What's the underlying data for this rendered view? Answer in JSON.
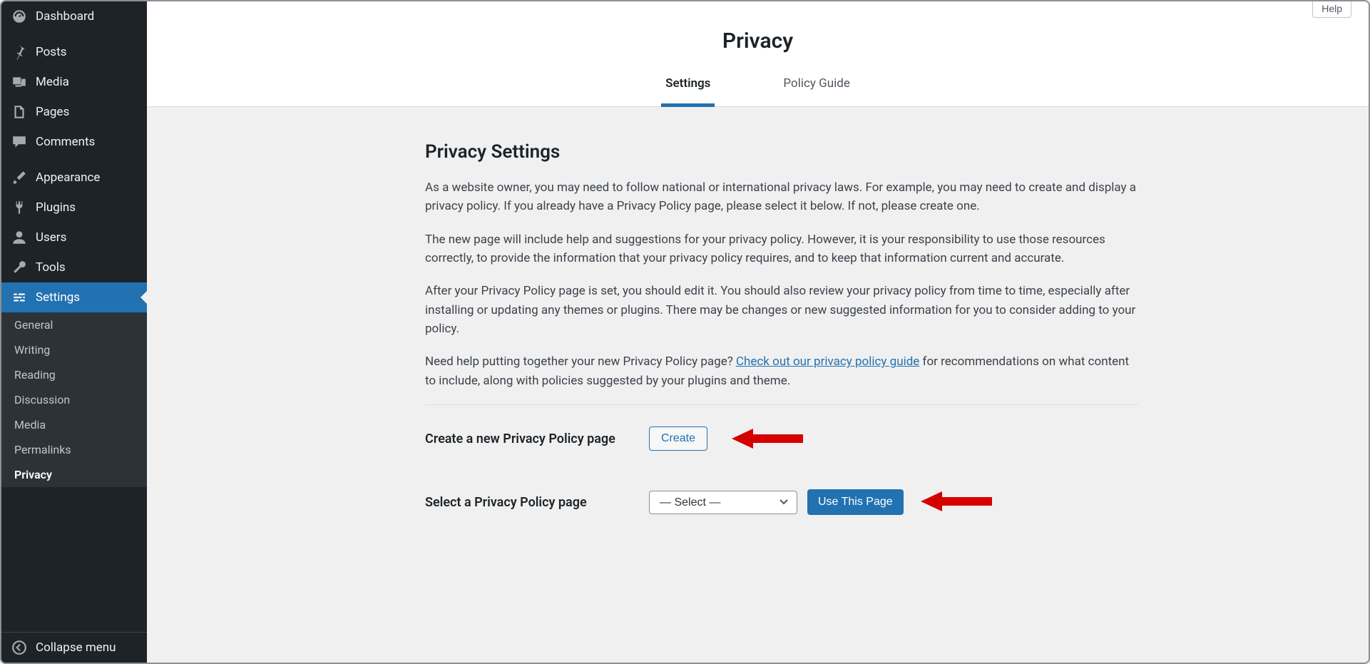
{
  "sidebar": {
    "items": [
      {
        "label": "Dashboard"
      },
      {
        "label": "Posts"
      },
      {
        "label": "Media"
      },
      {
        "label": "Pages"
      },
      {
        "label": "Comments"
      },
      {
        "label": "Appearance"
      },
      {
        "label": "Plugins"
      },
      {
        "label": "Users"
      },
      {
        "label": "Tools"
      },
      {
        "label": "Settings"
      }
    ],
    "submenu": [
      {
        "label": "General"
      },
      {
        "label": "Writing"
      },
      {
        "label": "Reading"
      },
      {
        "label": "Discussion"
      },
      {
        "label": "Media"
      },
      {
        "label": "Permalinks"
      },
      {
        "label": "Privacy"
      }
    ],
    "collapse": "Collapse menu"
  },
  "header": {
    "help": "Help",
    "title": "Privacy",
    "tabs": [
      {
        "label": "Settings"
      },
      {
        "label": "Policy Guide"
      }
    ]
  },
  "content": {
    "heading": "Privacy Settings",
    "p1": "As a website owner, you may need to follow national or international privacy laws. For example, you may need to create and display a privacy policy. If you already have a Privacy Policy page, please select it below. If not, please create one.",
    "p2": "The new page will include help and suggestions for your privacy policy. However, it is your responsibility to use those resources correctly, to provide the information that your privacy policy requires, and to keep that information current and accurate.",
    "p3": "After your Privacy Policy page is set, you should edit it. You should also review your privacy policy from time to time, especially after installing or updating any themes or plugins. There may be changes or new suggested information for you to consider adding to your policy.",
    "p4_prefix": "Need help putting together your new Privacy Policy page? ",
    "p4_link": "Check out our privacy policy guide",
    "p4_suffix": " for recommendations on what content to include, along with policies suggested by your plugins and theme.",
    "create_label": "Create a new Privacy Policy page",
    "create_btn": "Create",
    "select_label": "Select a Privacy Policy page",
    "select_placeholder": "— Select —",
    "use_btn": "Use This Page"
  }
}
